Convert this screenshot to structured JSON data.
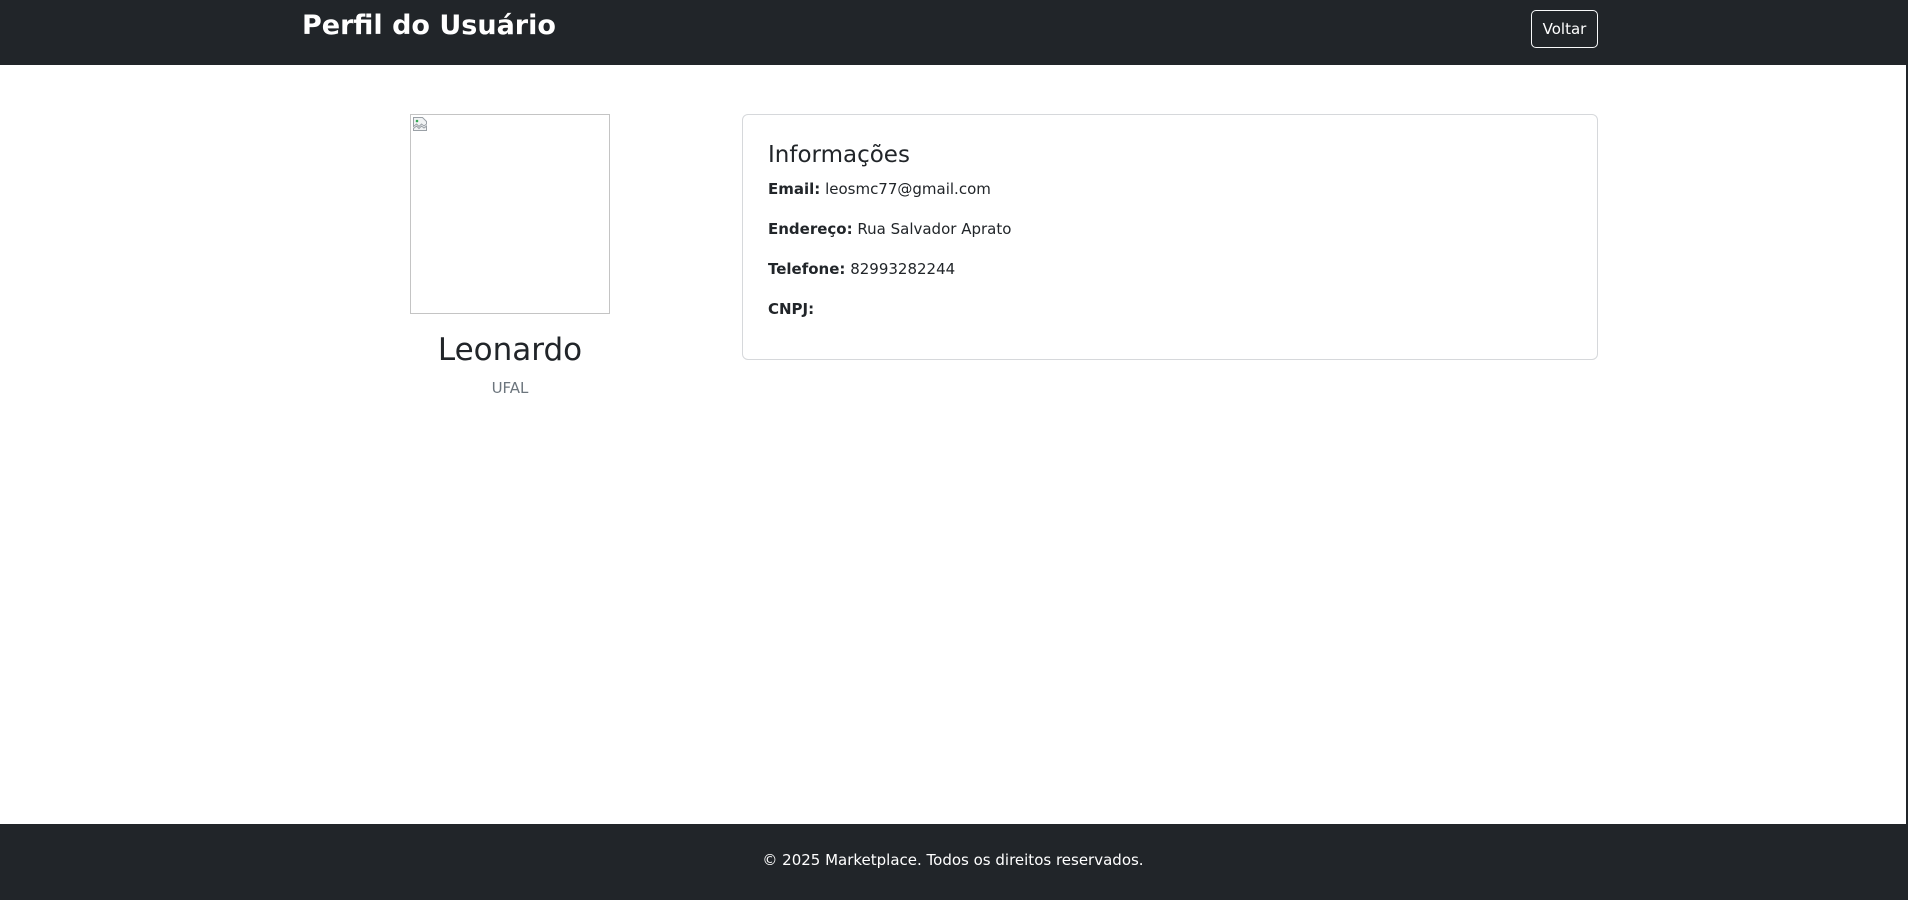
{
  "header": {
    "title": "Perfil do Usuário",
    "back_label": "Voltar"
  },
  "profile": {
    "name": "Leonardo",
    "organization": "UFAL",
    "avatar_icon": "broken-image-icon"
  },
  "info": {
    "title": "Informações",
    "fields": [
      {
        "label": "Email:",
        "value": "leosmc77@gmail.com"
      },
      {
        "label": "Endereço:",
        "value": "Rua Salvador Aprato"
      },
      {
        "label": "Telefone:",
        "value": "82993282244"
      },
      {
        "label": "CNPJ:",
        "value": ""
      }
    ]
  },
  "footer": {
    "text": "© 2025 Marketplace. Todos os direitos reservados."
  },
  "colors": {
    "dark": "#212529",
    "muted": "#6c757d",
    "border": "#d6d8db"
  }
}
